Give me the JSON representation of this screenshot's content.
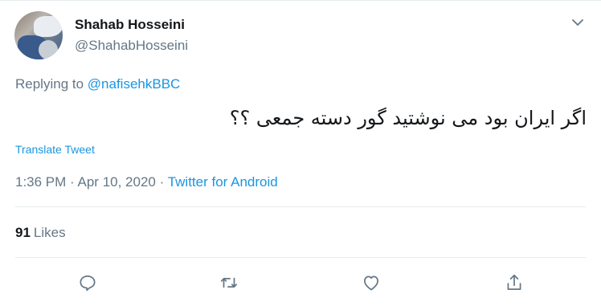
{
  "tweet": {
    "author": {
      "name": "Shahab Hosseini",
      "handle": "@ShahabHosseini",
      "avatar_icon": "profile-photo"
    },
    "replying_prefix": "Replying to",
    "replying_to": "@nafisehkBBC",
    "text": "اگر ایران بود می نوشتید گور دسته جمعی ؟؟",
    "translate_label": "Translate Tweet",
    "time": "1:36 PM",
    "separator": "·",
    "date": "Apr 10, 2020",
    "source": "Twitter for Android",
    "likes_count": "91",
    "likes_label": "Likes"
  },
  "actions": {
    "reply_icon": "reply-icon",
    "retweet_icon": "retweet-icon",
    "like_icon": "heart-icon",
    "share_icon": "share-icon"
  },
  "colors": {
    "link": "#1b95e0",
    "secondary_text": "#657786",
    "primary_text": "#14171a",
    "divider": "#e6ecf0"
  }
}
